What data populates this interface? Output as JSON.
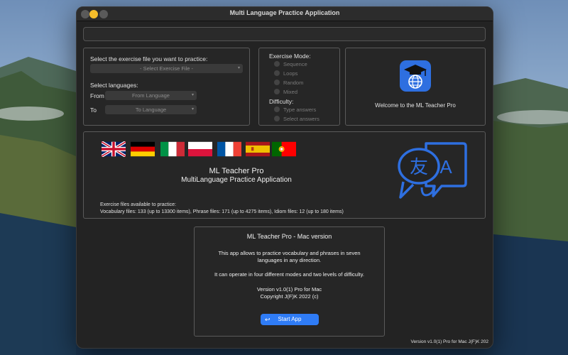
{
  "window": {
    "title": "Multi Language Practice Application"
  },
  "exercise_panel": {
    "file_prompt": "Select the exercise file you want to practice:",
    "file_placeholder": "- Select Exercise File -",
    "languages_label": "Select languages:",
    "from_label": "From",
    "from_placeholder": "From Language",
    "to_label": "To",
    "to_placeholder": "To Language"
  },
  "mode_panel": {
    "mode_label": "Exercise Mode:",
    "modes": [
      "Sequence",
      "Loops",
      "Random",
      "Mixed"
    ],
    "difficulty_label": "Difficulty:",
    "difficulties": [
      "Type answers",
      "Select answers"
    ]
  },
  "welcome_panel": {
    "icon": "graduation-cap-globe-icon",
    "text": "Welcome to the ML Teacher Pro"
  },
  "info_panel": {
    "flags": [
      "uk-flag",
      "germany-flag",
      "italy-flag",
      "poland-flag",
      "france-flag",
      "spain-flag",
      "portugal-flag"
    ],
    "app_name": "ML Teacher Pro",
    "app_subtitle": "MultiLanguage Practice Application",
    "files_heading": "Exercise files available to practice:",
    "files_detail": "Vocabulary files: 133 (up to 13300 items), Phrase files: 171 (up to 4275 items), Idiom files: 12 (up to 180 items)",
    "translate_icon": "translate-speech-bubbles-icon"
  },
  "about_panel": {
    "heading": "ML Teacher Pro - Mac version",
    "desc1": "This app allows to practice vocabulary and phrases in seven languages in any direction.",
    "desc2": "It can operate in four different modes and two levels of difficulty.",
    "version": "Version v1.0(1) Pro for Mac",
    "copyright": "Copyright J(F)K 2022 (c)",
    "start_label": "Start App"
  },
  "footer": {
    "version": "Version v1.0(1) Pro for Mac J(F)K 202"
  },
  "colors": {
    "accent": "#2f7cf6",
    "icon_blue": "#2e6fe0",
    "window_bg": "#232323"
  }
}
